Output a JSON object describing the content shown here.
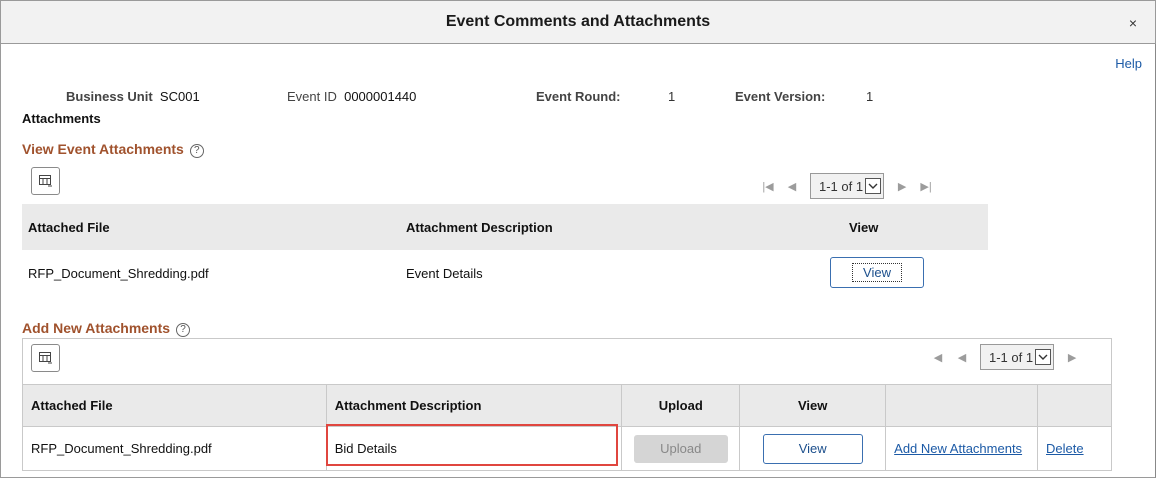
{
  "dialog": {
    "title": "Event Comments and Attachments",
    "close": "×"
  },
  "help": "Help",
  "header": {
    "business_unit_label": "Business Unit",
    "business_unit_value": "SC001",
    "event_id_label": "Event ID",
    "event_id_value": "0000001440",
    "event_round_label": "Event Round:",
    "event_round_value": "1",
    "event_version_label": "Event Version:",
    "event_version_value": "1"
  },
  "attachments_label": "Attachments",
  "view_section": {
    "title": "View Event Attachments",
    "pager": "1-1 of 1",
    "columns": [
      "Attached File",
      "Attachment Description",
      "View"
    ],
    "rows": [
      {
        "file": "RFP_Document_Shredding.pdf",
        "description": "Event Details",
        "view_label": "View"
      }
    ]
  },
  "add_section": {
    "title": "Add New Attachments",
    "pager": "1-1 of 1",
    "columns": [
      "Attached File",
      "Attachment Description",
      "Upload",
      "View",
      "",
      ""
    ],
    "rows": [
      {
        "file": "RFP_Document_Shredding.pdf",
        "description": "Bid Details",
        "upload_label": "Upload",
        "view_label": "View",
        "add_link": "Add New Attachments",
        "delete_link": "Delete"
      }
    ]
  },
  "icons": {
    "close": "close-icon",
    "help_question": "question-circle-icon",
    "grid_personalize": "grid-personalize-icon",
    "pager_first": "first-page-icon",
    "pager_prev": "previous-page-icon",
    "pager_next": "next-page-icon",
    "pager_last": "last-page-icon",
    "dropdown": "chevron-down-icon"
  },
  "colors": {
    "section_title": "#a0522d",
    "link": "#1c5aa6",
    "highlight": "#e0463f"
  }
}
